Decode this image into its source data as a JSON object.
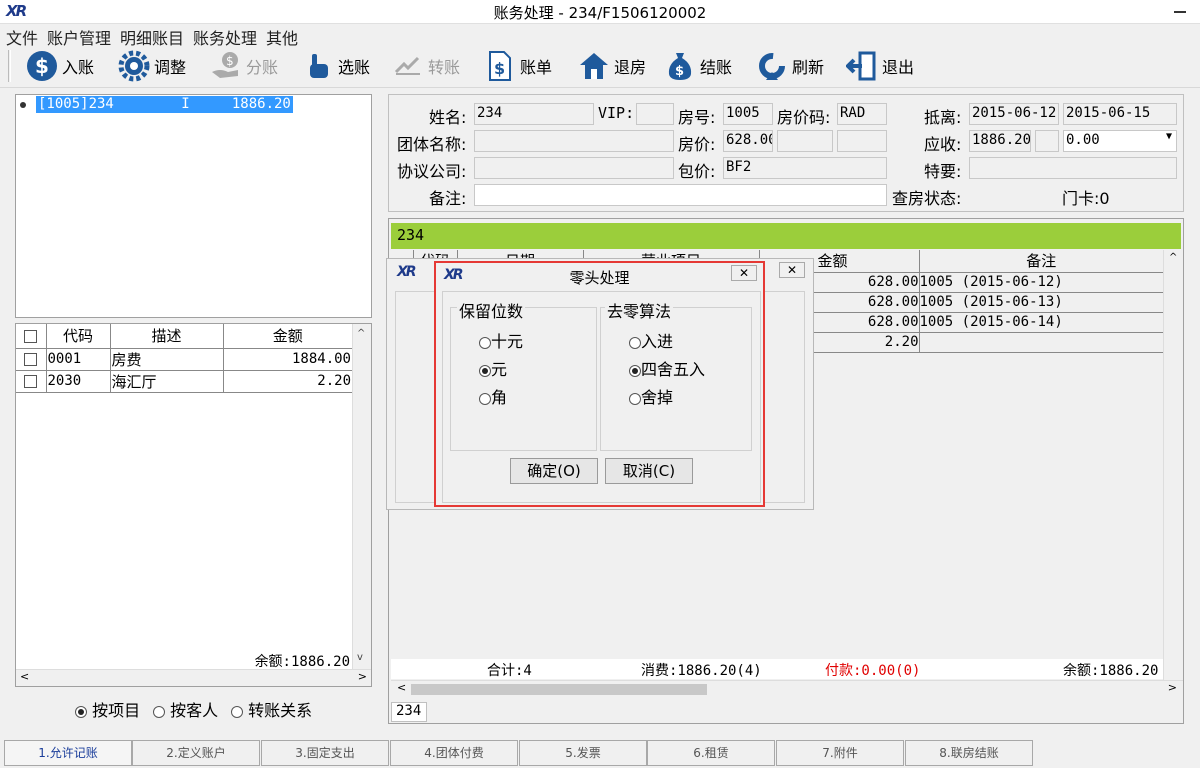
{
  "window": {
    "title": "账务处理 - 234/F1506120002",
    "logo": "XR"
  },
  "menu": [
    "文件",
    "账户管理",
    "明细账目",
    "账务处理",
    "其他"
  ],
  "toolbar": {
    "post": "入账",
    "adjust": "调整",
    "split": "分账",
    "select": "选账",
    "transfer": "转账",
    "bill": "账单",
    "checkout_room": "退房",
    "settle": "结账",
    "refresh": "刷新",
    "exit": "退出"
  },
  "account_tree": {
    "selected": "[1005]234        I     1886.20"
  },
  "items_table": {
    "headers": [
      "代码",
      "描述",
      "金额"
    ],
    "rows": [
      {
        "code": "0001",
        "desc": "房费",
        "amount": "1884.00"
      },
      {
        "code": "2030",
        "desc": "海汇厅",
        "amount": "2.20"
      }
    ],
    "balance": "余额:1886.20"
  },
  "view_options": {
    "by_item": "按项目",
    "by_guest": "按客人",
    "transfer_rel": "转账关系"
  },
  "guest_info": {
    "name_label": "姓名:",
    "name": "234",
    "vip_label": "VIP:",
    "vip": "",
    "room_label": "房号:",
    "room": "1005",
    "rate_code_label": "房价码:",
    "rate_code": "RAD",
    "dates_label": "抵离:",
    "arrival": "2015-06-12",
    "departure": "2015-06-15",
    "group_label": "团体名称:",
    "group": "",
    "price_label": "房价:",
    "price": "628.00",
    "receivable_label": "应收:",
    "receivable": "1886.20",
    "receivable_extra": "0.00",
    "company_label": "协议公司:",
    "company": "",
    "package_label": "包价:",
    "package": "BF2",
    "special_label": "特要:",
    "special": "",
    "note_label": "备注:",
    "note": "",
    "check_label": "查房状态:",
    "card_label": "门卡:0"
  },
  "ledger": {
    "header_title": "234",
    "columns": [
      "代码",
      "日期",
      "营业项目",
      "金额",
      "备注"
    ],
    "rows": [
      {
        "amount": "628.00",
        "note": "1005 (2015-06-12)"
      },
      {
        "amount": "628.00",
        "note": "1005 (2015-06-13)"
      },
      {
        "amount": "628.00",
        "note": "1005 (2015-06-14)"
      },
      {
        "amount": "2.20",
        "note": ""
      }
    ],
    "total": "合计:4",
    "consume": "消费:1886.20(4)",
    "paid": "付款:0.00(0)",
    "balance": "余额:1886.20",
    "footer_tag": "234"
  },
  "dialog": {
    "title": "零头处理",
    "group_digits": "保留位数",
    "digits": [
      "十元",
      "元",
      "角"
    ],
    "digits_selected": 1,
    "group_method": "去零算法",
    "methods": [
      "入进",
      "四舍五入",
      "舍掉"
    ],
    "methods_selected": 1,
    "ok": "确定(O)",
    "cancel": "取消(C)",
    "highlight_color": "#e53935"
  },
  "tabs": [
    "1.允许记账",
    "2.定义账户",
    "3.固定支出",
    "4.团体付费",
    "5.发票",
    "6.租赁",
    "7.附件",
    "8.联房结账"
  ],
  "colors": {
    "accent_green": "#9bce3b",
    "selection_blue": "#3399ff",
    "paid_red": "#e00000"
  }
}
